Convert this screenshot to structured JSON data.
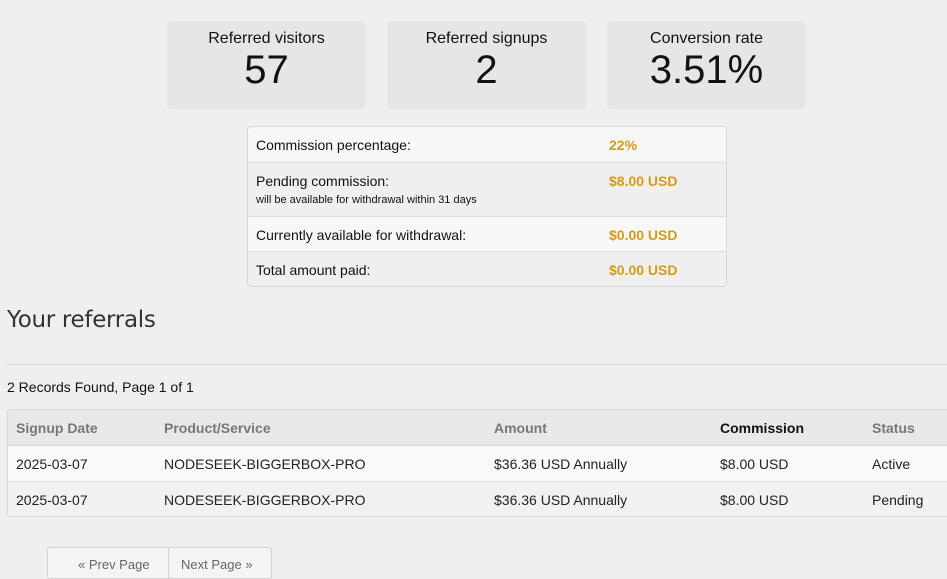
{
  "stats": [
    {
      "label": "Referred visitors",
      "value": "57"
    },
    {
      "label": "Referred signups",
      "value": "2"
    },
    {
      "label": "Conversion rate",
      "value": "3.51%"
    }
  ],
  "commission": {
    "rows": [
      {
        "label": "Commission percentage:",
        "value": "22%"
      },
      {
        "label": "Pending commission:",
        "note": "will be available for withdrawal within 31 days",
        "value": "$8.00 USD"
      },
      {
        "label": "Currently available for withdrawal:",
        "value": "$0.00 USD"
      },
      {
        "label": "Total amount paid:",
        "value": "$0.00 USD"
      }
    ],
    "value_color": "#d49b17"
  },
  "referrals": {
    "heading": "Your referrals",
    "records_text": "2 Records Found, Page 1 of 1",
    "columns": [
      "Signup Date",
      "Product/Service",
      "Amount",
      "Commission",
      "Status"
    ],
    "sorted_column": "Commission",
    "rows": [
      {
        "date": "2025-03-07",
        "product": "NODESEEK-BIGGERBOX-PRO",
        "amount": "$36.36 USD Annually",
        "commission": "$8.00 USD",
        "status": "Active"
      },
      {
        "date": "2025-03-07",
        "product": "NODESEEK-BIGGERBOX-PRO",
        "amount": "$36.36 USD Annually",
        "commission": "$8.00 USD",
        "status": "Pending"
      }
    ]
  },
  "pagination": {
    "prev": "« Prev Page",
    "next": "Next Page »"
  }
}
